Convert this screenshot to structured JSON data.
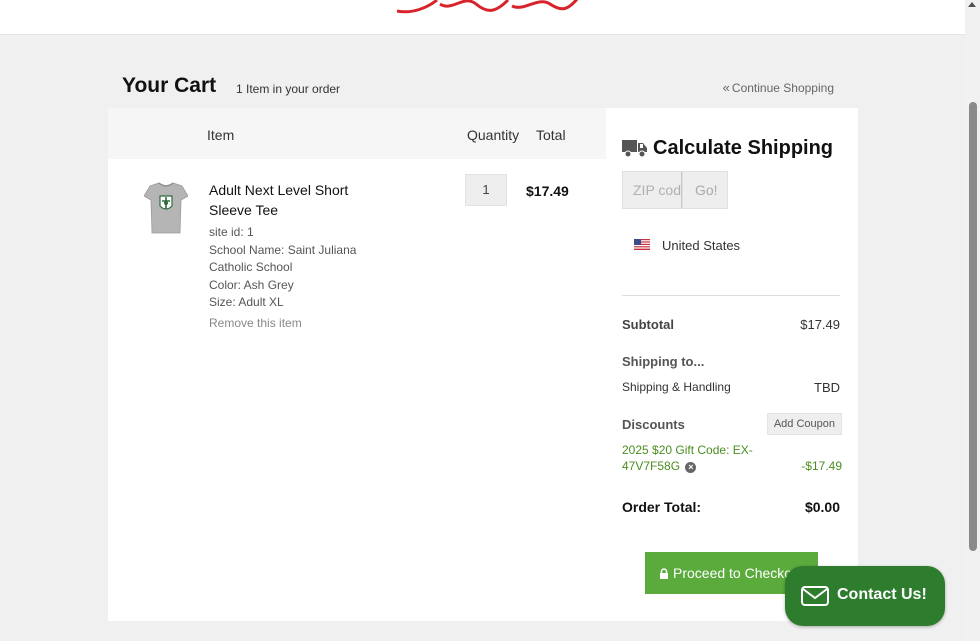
{
  "cart": {
    "title": "Your Cart",
    "item_count": "1 Item in your order",
    "continue_label": "Continue Shopping"
  },
  "table": {
    "headers": {
      "item": "Item",
      "quantity": "Quantity",
      "total": "Total"
    }
  },
  "items": [
    {
      "name": "Adult Next Level Short Sleeve Tee",
      "attributes": [
        "site id: 1",
        "School Name: Saint Juliana Catholic School",
        "Color: Ash Grey",
        "Size: Adult XL"
      ],
      "remove_label": "Remove this item",
      "quantity": "1",
      "total": "$17.49"
    }
  ],
  "shipping": {
    "title": "Calculate Shipping",
    "zip_placeholder": "ZIP code",
    "go_label": "Go!",
    "country": "United States"
  },
  "summary": {
    "subtotal_label": "Subtotal",
    "subtotal_value": "$17.49",
    "shipping_to_label": "Shipping to...",
    "handling_label": "Shipping & Handling",
    "handling_value": "TBD",
    "discounts_label": "Discounts",
    "add_coupon_label": "Add Coupon",
    "gift_code": "2025 $20 Gift Code: EX-47V7F58G",
    "gift_amount": "-$17.49",
    "order_total_label": "Order Total:",
    "order_total_value": "$0.00"
  },
  "checkout_label": "Proceed to Checkout",
  "contact_label": "Contact Us!",
  "colors": {
    "accent_green": "#5aaa3c",
    "discount_green": "#4a8e1f",
    "contact_green": "#2e7d2e",
    "logo_red": "#d8232a"
  },
  "icons": [
    "truck-icon",
    "us-flag-icon",
    "lock-icon",
    "remove-coupon-icon",
    "mail-icon",
    "chevron-left-double-icon",
    "tshirt-thumbnail"
  ]
}
